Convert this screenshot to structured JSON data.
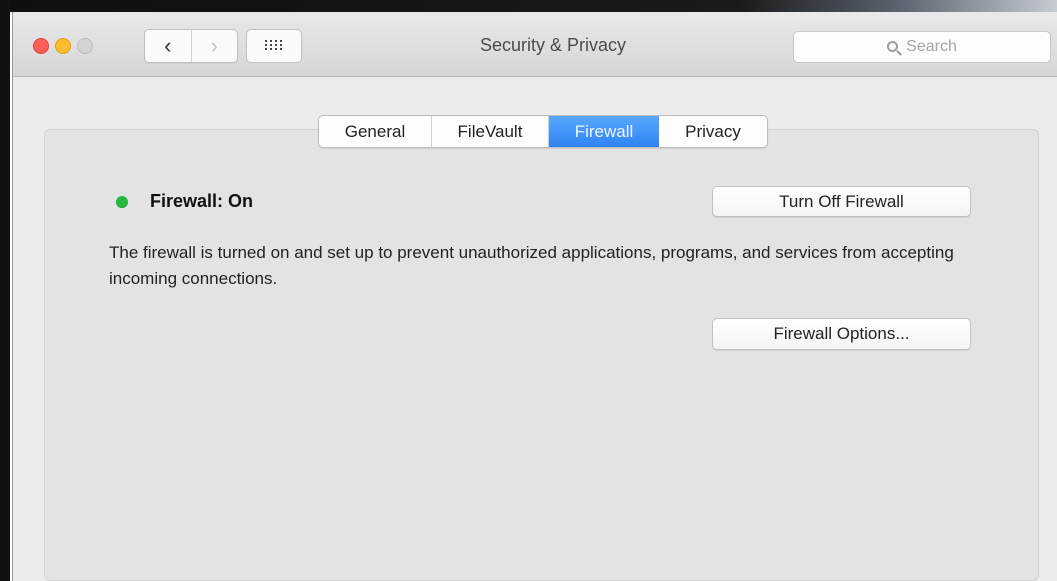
{
  "window": {
    "title": "Security & Privacy"
  },
  "toolbar": {
    "back_icon": "‹",
    "forward_icon": "›",
    "search_placeholder": "Search"
  },
  "tabs": [
    {
      "label": "General"
    },
    {
      "label": "FileVault"
    },
    {
      "label": "Firewall"
    },
    {
      "label": "Privacy"
    }
  ],
  "firewall": {
    "status": "Firewall: On",
    "turn_off_button": "Turn Off Firewall",
    "description": "The firewall is turned on and set up to prevent unauthorized applications, programs, and services from accepting incoming connections.",
    "options_button": "Firewall Options..."
  },
  "colors": {
    "status_on": "#28b83f",
    "selected_tab": "#2f84f2"
  }
}
